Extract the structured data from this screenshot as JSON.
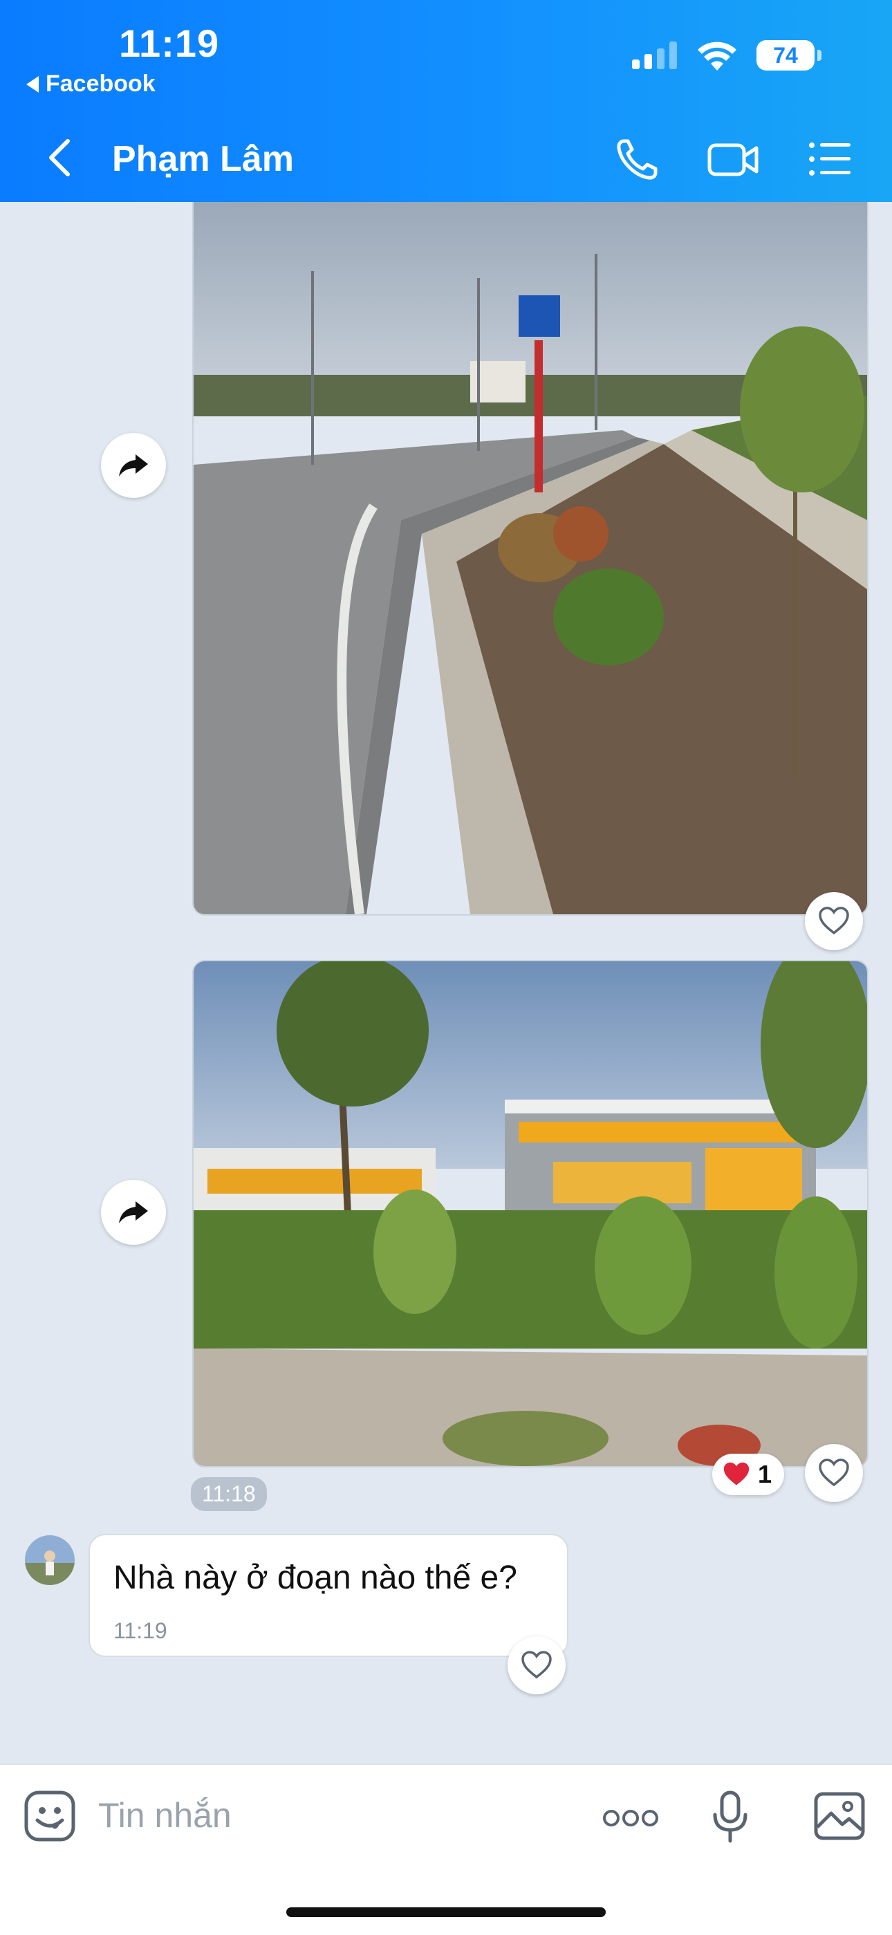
{
  "status_bar": {
    "time": "11:19",
    "back_app": "Facebook",
    "battery": "74"
  },
  "header": {
    "contact_name": "Phạm Lâm"
  },
  "messages": {
    "photo_group_time": "11:18",
    "reaction": {
      "emoji": "❤️",
      "count": "1"
    },
    "text_message": {
      "text": "Nhà này ở đoạn nào thế e?",
      "time": "11:19"
    }
  },
  "input": {
    "placeholder": "Tin nhắn"
  },
  "colors": {
    "header_blue": "#0a7cff",
    "chat_bg": "#e2e8f1",
    "heart_red": "#e0243a"
  }
}
